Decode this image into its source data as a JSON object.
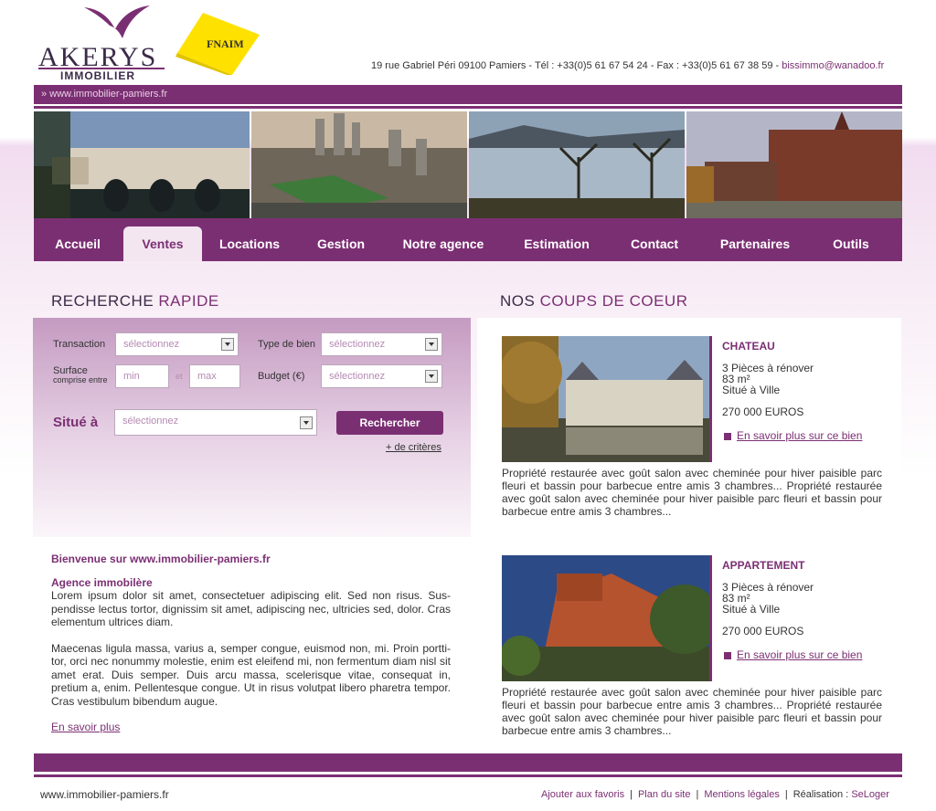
{
  "header": {
    "logo_name": "AKERYS",
    "logo_sub": "IMMOBILIER",
    "fnaim": "FNAIM",
    "contact": "19 rue Gabriel Péri 09100 Pamiers   -  Tél : +33(0)5 61 67 54 24 - Fax : +33(0)5 61 67 38 59 - ",
    "email": "bissimmo@wanadoo.fr",
    "url": "» www.immobilier-pamiers.fr"
  },
  "nav": {
    "items": [
      {
        "label": "Accueil"
      },
      {
        "label": "Ventes"
      },
      {
        "label": "Locations"
      },
      {
        "label": "Gestion"
      },
      {
        "label": "Notre agence"
      },
      {
        "label": "Estimation"
      },
      {
        "label": "Contact"
      },
      {
        "label": "Partenaires"
      },
      {
        "label": "Outils"
      }
    ]
  },
  "search": {
    "title_main": "RECHERCHE ",
    "title_accent": "RAPIDE",
    "transaction_label": "Transaction",
    "type_label": "Type de bien",
    "surface_label": "Surface",
    "surface_sub": "comprise entre",
    "budget_label": "Budget (€)",
    "situe_label": "Situé à",
    "select_placeholder": "sélectionnez",
    "min_placeholder": "min",
    "max_placeholder": "max",
    "and_label": "et",
    "button": "Rechercher",
    "more": "+ de critères"
  },
  "welcome": {
    "title": "Bienvenue sur www.immobilier-pamiers.fr",
    "subtitle": "Agence immobilère",
    "p1": "Lorem ipsum dolor sit amet, consectetuer adipiscing elit. Sed non risus. Sus-pendisse lectus tortor, dignissim sit amet, adipiscing nec, ultricies sed, dolor. Cras elementum ultrices diam.",
    "p2": "Maecenas ligula massa, varius a, semper congue, euismod non, mi. Proin portti-tor, orci nec nonummy molestie, enim est eleifend mi, non fermentum diam nisl sit amet erat. Duis semper. Duis arcu massa, scelerisque vitae, consequat in, pretium a, enim. Pellentesque congue. Ut in risus volutpat libero pharetra tempor. Cras vestibulum bibendum augue.",
    "more": "En savoir plus"
  },
  "coups": {
    "title_main": "NOS ",
    "title_accent": "COUPS DE COEUR",
    "items": [
      {
        "type": "CHATEAU",
        "rooms": "3 Pièces à rénover",
        "area": "83 m²",
        "location": "Situé à Ville",
        "price": "270 000 EUROS",
        "more": "En savoir plus sur ce bien",
        "desc": "Propriété restaurée avec goût salon avec cheminée pour hiver paisible parc fleuri et bassin pour barbecue entre amis 3 chambres... Propriété restaurée avec goût salon avec cheminée pour hiver paisible parc fleuri et bassin pour barbecue entre amis 3 chambres..."
      },
      {
        "type": "APPARTEMENT",
        "rooms": "3 Pièces à rénover",
        "area": "83 m²",
        "location": "Situé à Ville",
        "price": "270 000 EUROS",
        "more": "En savoir plus sur ce bien",
        "desc": "Propriété restaurée avec goût salon avec cheminée pour hiver paisible parc fleuri et bassin pour barbecue entre amis 3 chambres... Propriété restaurée avec goût salon avec cheminée pour hiver paisible parc fleuri et bassin pour barbecue entre amis 3 chambres..."
      }
    ]
  },
  "footer": {
    "url": "www.immobilier-pamiers.fr",
    "links": [
      "Ajouter aux favoris",
      "Plan du site",
      "Mentions légales"
    ],
    "credit_label": "Réalisation : ",
    "credit": "SeLoger"
  },
  "colors": {
    "brand": "#7b2f73",
    "dark": "#3b2b48",
    "fnaim": "#ffe100"
  }
}
